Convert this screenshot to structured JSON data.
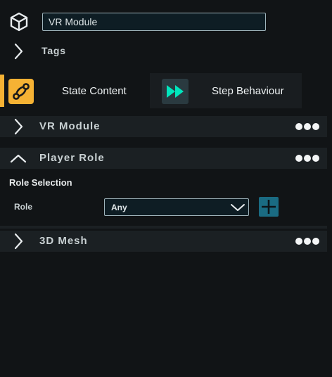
{
  "object": {
    "name_value": "VR Module"
  },
  "tags": {
    "label": "Tags"
  },
  "tabs": [
    {
      "label": "State Content",
      "icon": "state-content-icon",
      "active": true,
      "accent": "#f5b234"
    },
    {
      "label": "Step Behaviour",
      "icon": "fast-forward-icon",
      "active": false,
      "accent": "#00d9b4"
    }
  ],
  "sections": {
    "vr_module": {
      "title": "VR Module",
      "expanded": false
    },
    "player_role": {
      "title": "Player Role",
      "expanded": true,
      "group_label": "Role Selection",
      "field_label": "Role",
      "field_value": "Any"
    },
    "mesh": {
      "title": "3D Mesh",
      "expanded": false
    }
  },
  "colors": {
    "background": "#111416",
    "section_header": "#1b2023",
    "input_bg": "#0e1d24",
    "add_button": "#1a6b82"
  }
}
